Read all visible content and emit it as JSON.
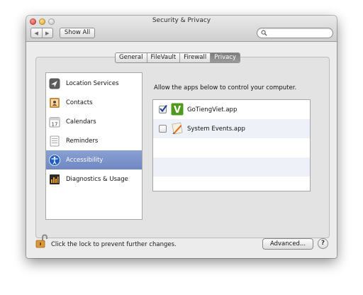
{
  "window": {
    "title": "Security & Privacy",
    "nav": {
      "back": "◀",
      "forward": "▶"
    },
    "show_all": "Show All",
    "search": {
      "placeholder": ""
    }
  },
  "tabs": [
    {
      "label": "General",
      "active": false
    },
    {
      "label": "FileVault",
      "active": false
    },
    {
      "label": "Firewall",
      "active": false
    },
    {
      "label": "Privacy",
      "active": true
    }
  ],
  "sidebar": {
    "items": [
      {
        "label": "Location Services",
        "icon": "location-arrow-icon",
        "selected": false
      },
      {
        "label": "Contacts",
        "icon": "contacts-book-icon",
        "selected": false
      },
      {
        "label": "Calendars",
        "icon": "calendar-icon",
        "selected": false,
        "icon_text": "17"
      },
      {
        "label": "Reminders",
        "icon": "reminders-list-icon",
        "selected": false
      },
      {
        "label": "Accessibility",
        "icon": "accessibility-icon",
        "selected": true
      },
      {
        "label": "Diagnostics & Usage",
        "icon": "diagnostics-chart-icon",
        "selected": false
      }
    ]
  },
  "main": {
    "allow_text": "Allow the apps below to control your computer.",
    "apps": [
      {
        "name": "GoTiengViet.app",
        "checked": true,
        "icon": "gotiengviet-app-icon",
        "icon_text": "V"
      },
      {
        "name": "System Events.app",
        "checked": false,
        "icon": "system-events-app-icon"
      }
    ]
  },
  "footer": {
    "lock_text": "Click the lock to prevent further changes.",
    "advanced_label": "Advanced...",
    "help_label": "?"
  },
  "colors": {
    "selection": "#7890c8",
    "tab_active": "#8a8a8a",
    "gotiengviet_green": "#4e9a1e"
  }
}
